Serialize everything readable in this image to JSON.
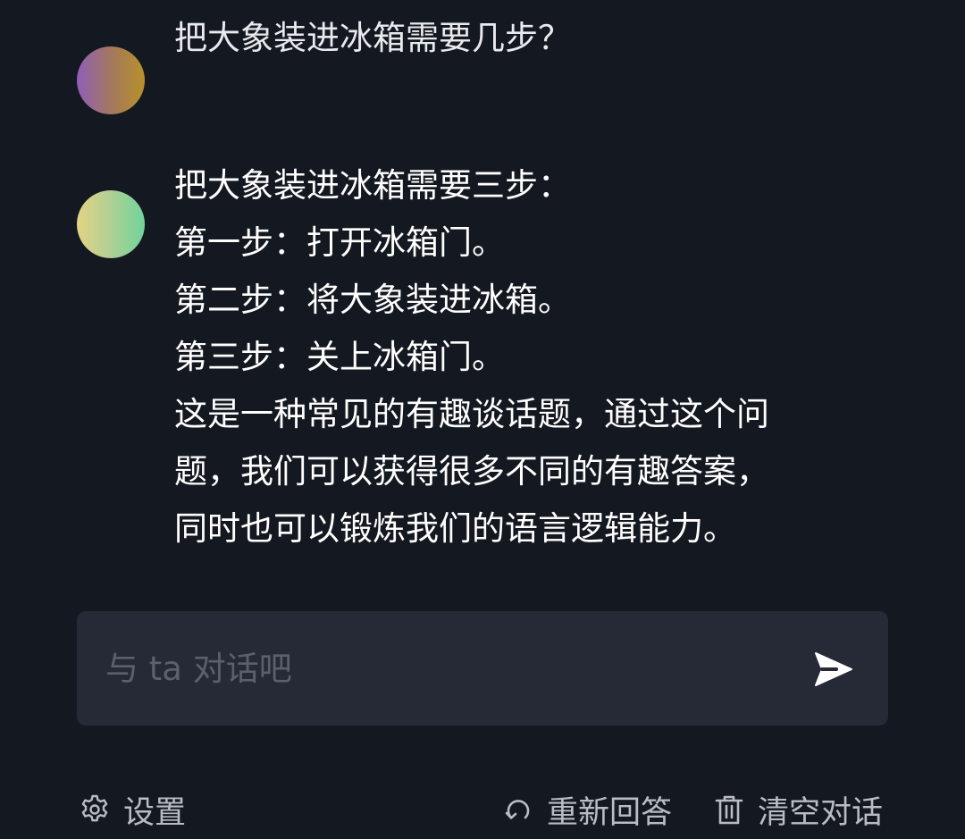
{
  "conversation": {
    "user_message": {
      "avatar": "user-avatar-gradient-purple-gold",
      "text": "把大象装进冰箱需要几步？"
    },
    "bot_message": {
      "avatar": "bot-avatar-gradient-yellow-green",
      "lines": [
        "把大象装进冰箱需要三步：",
        "第一步：打开冰箱门。",
        "第二步：将大象装进冰箱。",
        "第三步：关上冰箱门。",
        "这是一种常见的有趣谈话题，通过这个问",
        "题，我们可以获得很多不同的有趣答案，",
        "同时也可以锻炼我们的语言逻辑能力。"
      ]
    }
  },
  "composer": {
    "placeholder": "与 ta 对话吧",
    "value": "",
    "send_icon": "send-icon"
  },
  "footer": {
    "settings_label": "设置",
    "settings_icon": "gear-icon",
    "regenerate_label": "重新回答",
    "regenerate_icon": "refresh-icon",
    "clear_label": "清空对话",
    "clear_icon": "trash-icon"
  },
  "colors": {
    "background": "#141820",
    "composer_bg": "#262a36",
    "text_primary": "#ffffff",
    "text_muted": "#b9bcc4",
    "placeholder": "#5b606c"
  }
}
